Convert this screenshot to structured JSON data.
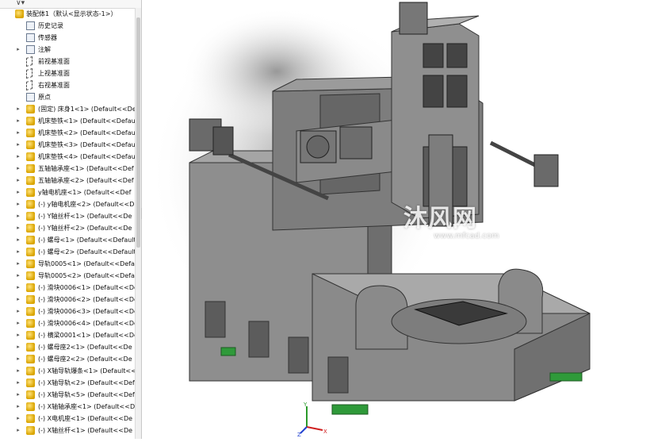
{
  "feature_tree": {
    "root": {
      "label": "装配体1（默认<显示状态-1>）"
    },
    "items": [
      {
        "label": "历史记录",
        "level": 1,
        "icon": "history-icon",
        "expand": ""
      },
      {
        "label": "传感器",
        "level": 1,
        "icon": "sensor-icon",
        "expand": ""
      },
      {
        "label": "注解",
        "level": 1,
        "icon": "annotation-icon",
        "expand": "▸"
      },
      {
        "label": "前视基准面",
        "level": 1,
        "icon": "plane-icon",
        "expand": ""
      },
      {
        "label": "上视基准面",
        "level": 1,
        "icon": "plane-icon",
        "expand": ""
      },
      {
        "label": "右视基准面",
        "level": 1,
        "icon": "plane-icon",
        "expand": ""
      },
      {
        "label": "原点",
        "level": 1,
        "icon": "origin-icon",
        "expand": ""
      },
      {
        "label": "(固定) 床身1<1> (Default<<De",
        "level": 1,
        "icon": "part-icon",
        "expand": "▸"
      },
      {
        "label": "机床垫铁<1> (Default<<Defau",
        "level": 1,
        "icon": "part-icon",
        "expand": "▸"
      },
      {
        "label": "机床垫铁<2> (Default<<Defau",
        "level": 1,
        "icon": "part-icon",
        "expand": "▸"
      },
      {
        "label": "机床垫铁<3> (Default<<Defau",
        "level": 1,
        "icon": "part-icon",
        "expand": "▸"
      },
      {
        "label": "机床垫铁<4> (Default<<Defau",
        "level": 1,
        "icon": "part-icon",
        "expand": "▸"
      },
      {
        "label": "五轴轴承座<1> (Default<<Def",
        "level": 1,
        "icon": "part-icon",
        "expand": "▸"
      },
      {
        "label": "五轴轴承座<2> (Default<<Def",
        "level": 1,
        "icon": "part-icon",
        "expand": "▸"
      },
      {
        "label": "y轴电机座<1> (Default<<Def",
        "level": 1,
        "icon": "part-icon",
        "expand": "▸"
      },
      {
        "label": "(-) y轴电机座<2> (Default<<D",
        "level": 1,
        "icon": "part-icon",
        "expand": "▸"
      },
      {
        "label": "(-) Y轴丝杆<1> (Default<<De",
        "level": 1,
        "icon": "part-icon",
        "expand": "▸"
      },
      {
        "label": "(-) Y轴丝杆<2> (Default<<De",
        "level": 1,
        "icon": "part-icon",
        "expand": "▸"
      },
      {
        "label": "(-) 螺母<1> (Default<<Default",
        "level": 1,
        "icon": "part-icon",
        "expand": "▸"
      },
      {
        "label": "(-) 螺母<2> (Default<<Default",
        "level": 1,
        "icon": "part-icon",
        "expand": "▸"
      },
      {
        "label": "导轨0005<1> (Default<<Defa",
        "level": 1,
        "icon": "part-icon",
        "expand": "▸"
      },
      {
        "label": "导轨0005<2> (Default<<Defa",
        "level": 1,
        "icon": "part-icon",
        "expand": "▸"
      },
      {
        "label": "(-) 滑块0006<1> (Default<<De",
        "level": 1,
        "icon": "part-icon",
        "expand": "▸"
      },
      {
        "label": "(-) 滑块0006<2> (Default<<De",
        "level": 1,
        "icon": "part-icon",
        "expand": "▸"
      },
      {
        "label": "(-) 滑块0006<3> (Default<<De",
        "level": 1,
        "icon": "part-icon",
        "expand": "▸"
      },
      {
        "label": "(-) 滑块0006<4> (Default<<De",
        "level": 1,
        "icon": "part-icon",
        "expand": "▸"
      },
      {
        "label": "(-) 横梁0001<1> (Default<<De",
        "level": 1,
        "icon": "part-icon",
        "expand": "▸"
      },
      {
        "label": "(-) 螺母座2<1> (Default<<De",
        "level": 1,
        "icon": "part-icon",
        "expand": "▸"
      },
      {
        "label": "(-) 螺母座2<2> (Default<<De",
        "level": 1,
        "icon": "part-icon",
        "expand": "▸"
      },
      {
        "label": "(-) X轴导轨爆条<1> (Default<<",
        "level": 1,
        "icon": "part-icon",
        "expand": "▸"
      },
      {
        "label": "(-) X轴导轨<2> (Default<<Def",
        "level": 1,
        "icon": "part-icon",
        "expand": "▸"
      },
      {
        "label": "(-) X轴导轨<5> (Default<<Def",
        "level": 1,
        "icon": "part-icon",
        "expand": "▸"
      },
      {
        "label": "(-) X轴轴承座<1> (Default<<D",
        "level": 1,
        "icon": "part-icon",
        "expand": "▸"
      },
      {
        "label": "(-) X电机座<1> (Default<<De",
        "level": 1,
        "icon": "part-icon",
        "expand": "▸"
      },
      {
        "label": "(-) X轴丝杆<1> (Default<<De",
        "level": 1,
        "icon": "part-icon",
        "expand": "▸"
      }
    ]
  },
  "watermark": {
    "logo": "沐风网",
    "url": "www.mfcad.com"
  },
  "triad": {
    "x": "X",
    "y": "Y",
    "z": "Z"
  },
  "colors": {
    "machine_body": "#8c8c8c",
    "feet": "#2f9a3a",
    "part_icon": "#e0b000"
  }
}
